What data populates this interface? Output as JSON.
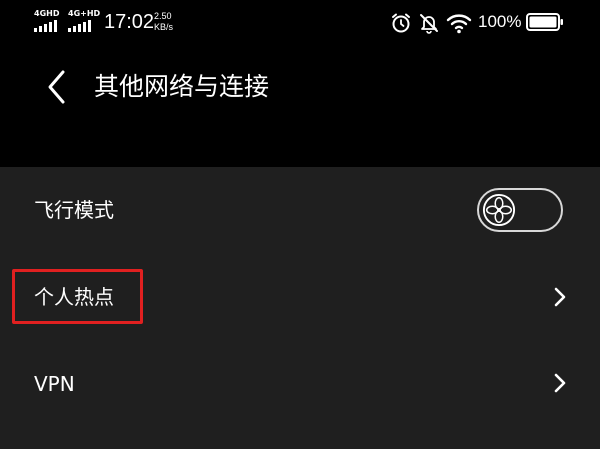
{
  "status_bar": {
    "network1": "4GHD",
    "network2": "4G+HD",
    "time": "17:02",
    "speed_value": "2.50",
    "speed_unit": "KB/s",
    "battery_percent": "100%",
    "battery_level": 1.0,
    "icons": [
      "signal-icon",
      "signal-icon",
      "alarm-icon",
      "mute-icon",
      "wifi-icon",
      "battery-icon"
    ]
  },
  "header": {
    "back_icon": "chevron-left-icon",
    "title": "其他网络与连接"
  },
  "settings": {
    "items": [
      {
        "label": "飞行模式",
        "control": "toggle",
        "state": "off"
      },
      {
        "label": "个人热点",
        "control": "chevron-right-icon"
      },
      {
        "label": "VPN",
        "control": "chevron-right-icon"
      }
    ]
  },
  "colors": {
    "background_top": "#000000",
    "list_background": "#1f1f1f",
    "text": "#ffffff",
    "highlight": "#e02020",
    "toggle_border": "#d8d8d8"
  }
}
